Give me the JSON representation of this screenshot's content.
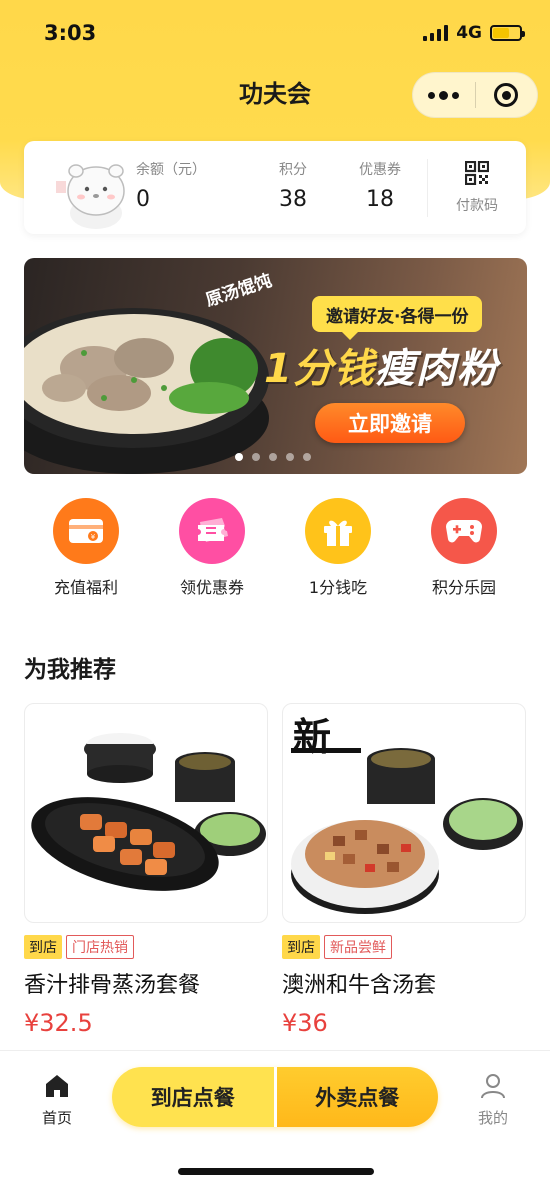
{
  "status_bar": {
    "time": "3:03",
    "network": "4G"
  },
  "header": {
    "title": "功夫会"
  },
  "account": {
    "balance_label": "余额（元）",
    "balance_value": "0",
    "points_label": "积分",
    "points_value": "38",
    "coupons_label": "优惠券",
    "coupons_value": "18",
    "paycode_label": "付款码"
  },
  "banner": {
    "stamp": "原汤馄饨",
    "tag": "邀请好友·各得一份",
    "headline_em": "1分钱",
    "headline": "瘦肉粉",
    "cta": "立即邀请",
    "page_count": 5,
    "active_page": 1
  },
  "shortcuts": [
    {
      "label": "充值福利",
      "icon": "recharge-card-icon",
      "color": "#ff7a1a"
    },
    {
      "label": "领优惠券",
      "icon": "coupon-ticket-icon",
      "color": "#ff4fa3"
    },
    {
      "label": "1分钱吃",
      "icon": "gift-box-icon",
      "color": "#ffc31a"
    },
    {
      "label": "积分乐园",
      "icon": "gamepad-icon",
      "color": "#f5574a"
    }
  ],
  "recommend": {
    "title": "为我推荐",
    "items": [
      {
        "tag_primary": "到店",
        "tag_secondary": "门店热销",
        "name": "香汁排骨蒸汤套餐",
        "price": "¥32.5"
      },
      {
        "tag_primary": "到店",
        "tag_secondary": "新品尝鲜",
        "name": "澳洲和牛含汤套",
        "price": "¥36",
        "badge": "新"
      }
    ]
  },
  "tabbar": {
    "home_label": "首页",
    "dine_in_label": "到店点餐",
    "takeout_label": "外卖点餐",
    "me_label": "我的"
  },
  "colors": {
    "brand_yellow": "#ffd84a",
    "price_red": "#e8413d",
    "cta_orange": "#ff6a1a"
  }
}
